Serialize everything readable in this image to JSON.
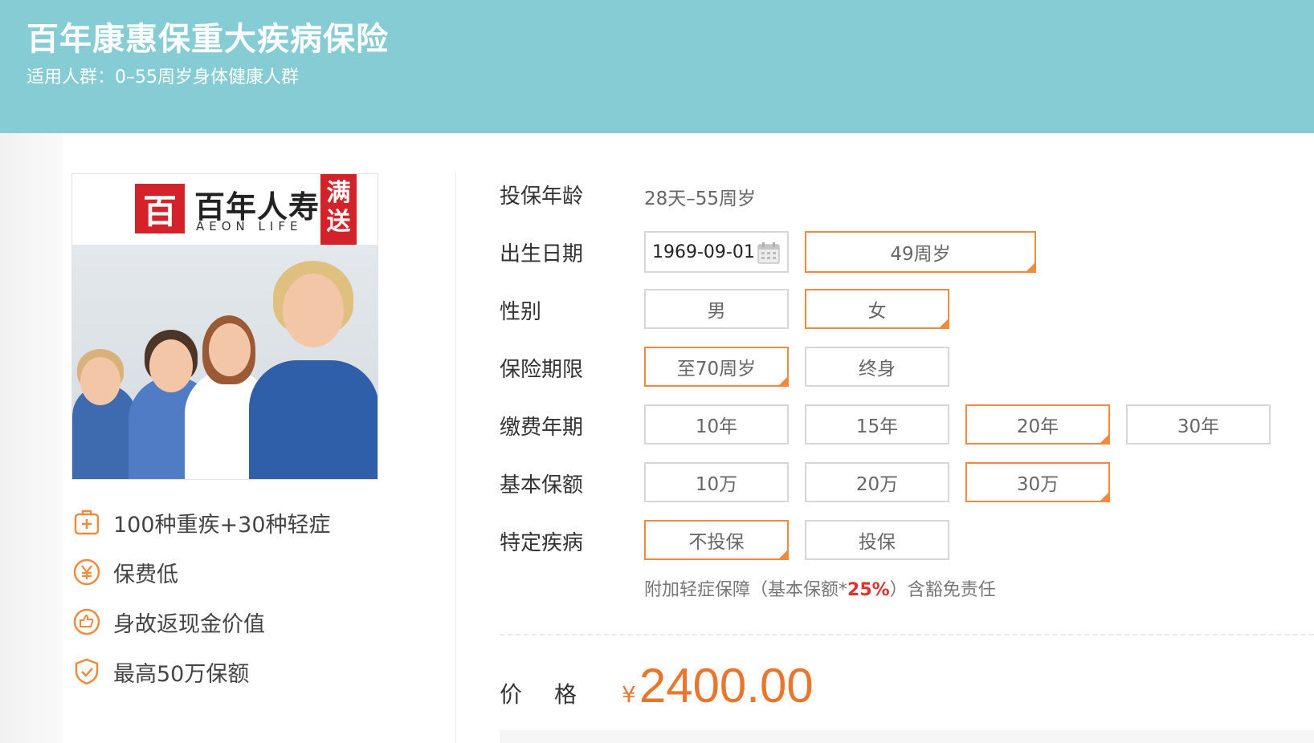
{
  "header": {
    "title": "百年康惠保重大疾病保险",
    "subtitle": "适用人群：0–55周岁身体健康人群"
  },
  "product_image": {
    "logo_mark": "百",
    "logo_cn": "百年人寿",
    "logo_en": "AEON LIFE",
    "promo": [
      "满",
      "送"
    ]
  },
  "features": [
    {
      "icon": "medical-kit-icon",
      "text": "100种重疾+30种轻症"
    },
    {
      "icon": "yen-coin-icon",
      "text": "保费低"
    },
    {
      "icon": "hand-cash-icon",
      "text": "身故返现金价值"
    },
    {
      "icon": "shield-check-icon",
      "text": "最高50万保额"
    }
  ],
  "form": {
    "age": {
      "label": "投保年龄",
      "value": "28天–55周岁"
    },
    "birth": {
      "label": "出生日期",
      "date": "1969-09-01",
      "age_display": "49周岁"
    },
    "gender": {
      "label": "性别",
      "options": [
        "男",
        "女"
      ],
      "selected": "女"
    },
    "term": {
      "label": "保险期限",
      "options": [
        "至70周岁",
        "终身"
      ],
      "selected": "至70周岁"
    },
    "payment": {
      "label": "缴费年期",
      "options": [
        "10年",
        "15年",
        "20年",
        "30年"
      ],
      "selected": "20年"
    },
    "amount": {
      "label": "基本保额",
      "options": [
        "10万",
        "20万",
        "30万"
      ],
      "selected": "30万"
    },
    "disease": {
      "label": "特定疾病",
      "options": [
        "不投保",
        "投保"
      ],
      "selected": "不投保"
    },
    "note_before": "附加轻症保障（基本保额*",
    "note_highlight": "25%",
    "note_after": "）含豁免责任"
  },
  "price": {
    "label": "价格",
    "currency": "¥",
    "amount": "2400.00"
  },
  "colors": {
    "header_bg": "#86ccd4",
    "accent": "#f08a3c",
    "price": "#e8762f",
    "highlight": "#e0312a",
    "brand_red": "#d3222a"
  }
}
